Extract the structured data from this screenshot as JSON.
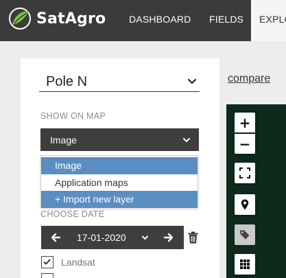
{
  "header": {
    "brand": "SatAgro",
    "nav": [
      "DASHBOARD",
      "FIELDS",
      "EXPLO"
    ]
  },
  "field": {
    "name": "Pole N"
  },
  "compare_link": "compare",
  "show_on_map": {
    "label": "SHOW ON MAP",
    "selected": "Image",
    "options": [
      "Image",
      "Application maps",
      "+ Import new layer"
    ]
  },
  "choose_date": {
    "label": "CHOOSE DATE",
    "date": "17-01-2020"
  },
  "sources": [
    {
      "label": "Landsat",
      "checked": true
    }
  ],
  "colors": {
    "nav_bg": "#3b3b3b",
    "control_dark": "#3e3e3e",
    "highlight": "#5b8ec2",
    "logo_green": "#7cc242",
    "map_bg": "#0e2a1c"
  }
}
